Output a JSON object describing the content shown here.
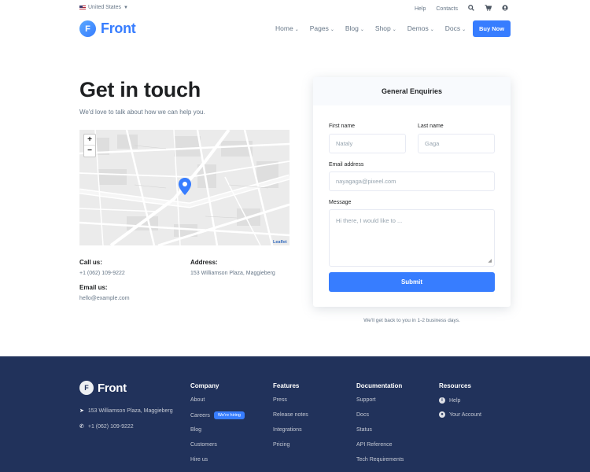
{
  "topbar": {
    "locale": "United States",
    "links": [
      "Help",
      "Contacts"
    ]
  },
  "header": {
    "logo_letter": "F",
    "logo_text": "Front",
    "nav": [
      "Home",
      "Pages",
      "Blog",
      "Shop",
      "Demos",
      "Docs"
    ],
    "buy_label": "Buy Now"
  },
  "hero": {
    "title": "Get in touch",
    "subtitle": "We'd love to talk about how we can help you."
  },
  "map": {
    "zoom_in": "+",
    "zoom_out": "−",
    "attribution": "Leaflet"
  },
  "contact": {
    "call_label": "Call us:",
    "call_value": "+1 (062) 109-9222",
    "address_label": "Address:",
    "address_value": "153 Williamson Plaza, Maggieberg",
    "email_label": "Email us:",
    "email_value": "hello@example.com"
  },
  "form": {
    "heading": "General Enquiries",
    "first_name_label": "First name",
    "first_name_placeholder": "Nataly",
    "last_name_label": "Last name",
    "last_name_placeholder": "Gaga",
    "email_label": "Email address",
    "email_placeholder": "nayagaga@pixeel.com",
    "message_label": "Message",
    "message_placeholder": "Hi there, I would like to ...",
    "submit_label": "Submit",
    "note": "We'll get back to you in 1-2 business days."
  },
  "footer": {
    "logo_letter": "F",
    "logo_text": "Front",
    "address": "153 Williamson Plaza, Maggieberg",
    "phone": "+1 (062) 109-9222",
    "columns": [
      {
        "heading": "Company",
        "links": [
          "About",
          "Careers",
          "Blog",
          "Customers",
          "Hire us"
        ],
        "badge": "We're hiring"
      },
      {
        "heading": "Features",
        "links": [
          "Press",
          "Release notes",
          "Integrations",
          "Pricing"
        ]
      },
      {
        "heading": "Documentation",
        "links": [
          "Support",
          "Docs",
          "Status",
          "API Reference",
          "Tech Requirements"
        ]
      },
      {
        "heading": "Resources",
        "links": [
          "Help",
          "Your Account"
        ]
      }
    ]
  },
  "colors": {
    "accent": "#377dff",
    "footer_bg": "#21325b",
    "text": "#1e2022",
    "muted": "#677788"
  }
}
